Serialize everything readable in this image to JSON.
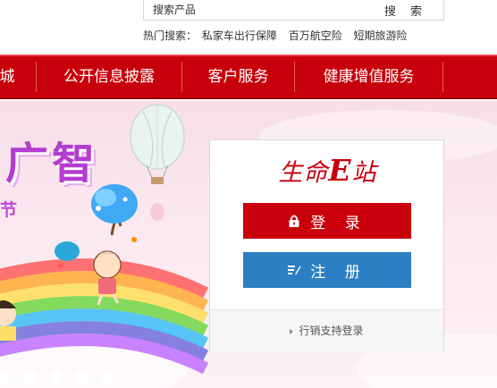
{
  "search": {
    "placeholder": "搜索产品",
    "button_label": "搜 索"
  },
  "hot_search": {
    "label": "热门搜索：",
    "links": [
      "私家车出行保障",
      "百万航空险",
      "短期旅游险"
    ]
  },
  "nav": {
    "items": [
      "城",
      "公开信息披露",
      "客户服务",
      "健康增值服务"
    ]
  },
  "banner": {
    "title": "广智",
    "subtitle": "节",
    "slide_count": 5
  },
  "login_panel": {
    "logo_prefix": "生命",
    "logo_e": "E",
    "logo_suffix": "站",
    "login_label": "登 录",
    "register_label": "注 册",
    "agent_link": "行销支持登录"
  },
  "colors": {
    "brand_red": "#c7000b",
    "register_blue": "#2b7fc2"
  },
  "icons": {
    "login": "lock-icon",
    "register": "edit-list-icon"
  }
}
